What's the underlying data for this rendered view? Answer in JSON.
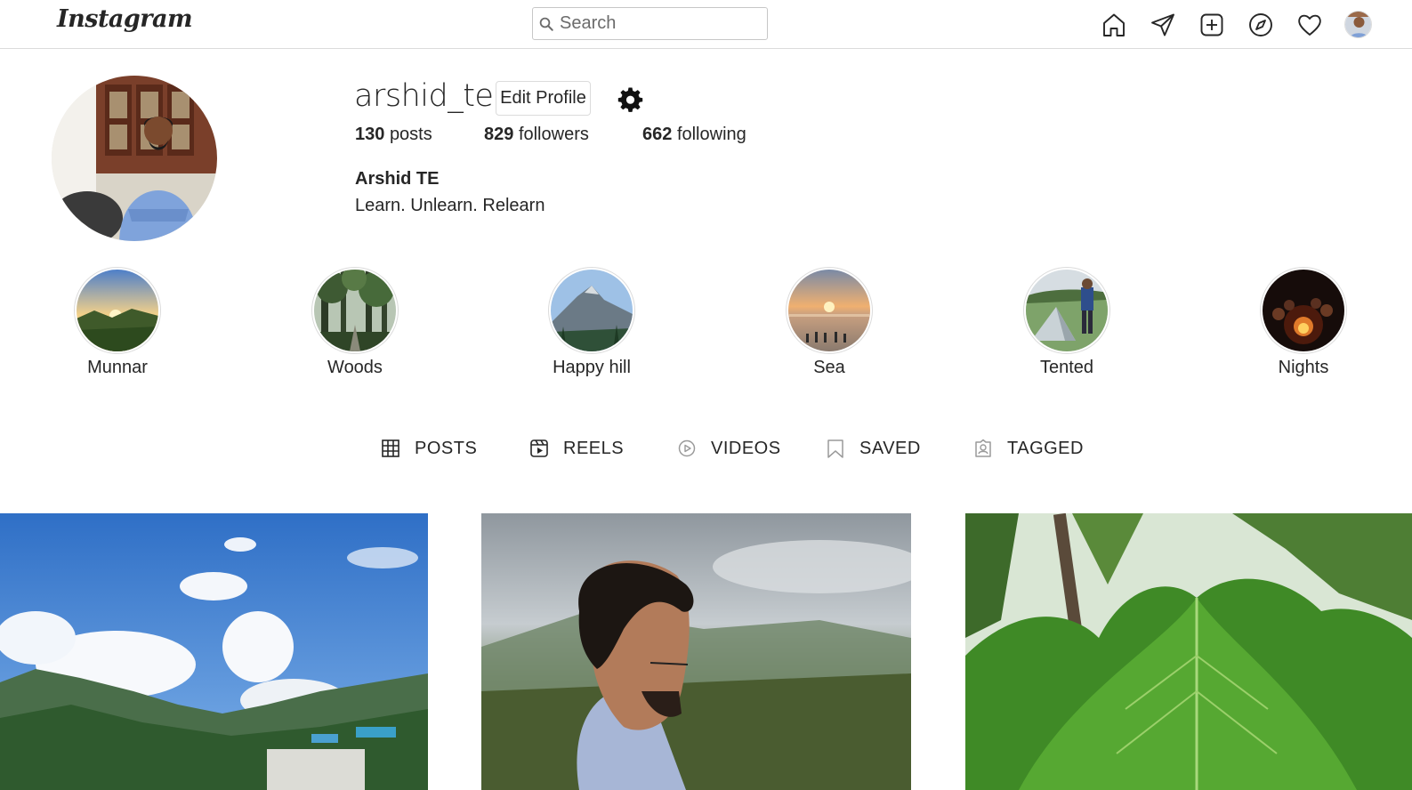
{
  "app": {
    "logo": "Instagram"
  },
  "search": {
    "placeholder": "Search"
  },
  "nav": {
    "icons": [
      "home-icon",
      "direct-icon",
      "new-post-icon",
      "explore-icon",
      "activity-icon",
      "profile-avatar"
    ]
  },
  "profile": {
    "username": "arshid_te",
    "edit_label": "Edit Profile",
    "posts_count": "130",
    "posts_label": "posts",
    "followers_count": "829",
    "followers_label": "followers",
    "following_count": "662",
    "following_label": "following",
    "full_name": "Arshid TE",
    "bio": "Learn. Unlearn. Relearn"
  },
  "highlights": [
    {
      "label": "Munnar"
    },
    {
      "label": "Woods"
    },
    {
      "label": "Happy hill"
    },
    {
      "label": "Sea"
    },
    {
      "label": "Tented"
    },
    {
      "label": "Nights"
    }
  ],
  "tabs": [
    {
      "label": "POSTS",
      "icon": "grid-icon"
    },
    {
      "label": "REELS",
      "icon": "reels-icon"
    },
    {
      "label": "VIDEOS",
      "icon": "video-play-icon"
    },
    {
      "label": "SAVED",
      "icon": "bookmark-icon"
    },
    {
      "label": "TAGGED",
      "icon": "tagged-icon"
    }
  ],
  "colors": {
    "border": "#dbdbdb",
    "text": "#262626",
    "background": "#ffffff"
  }
}
